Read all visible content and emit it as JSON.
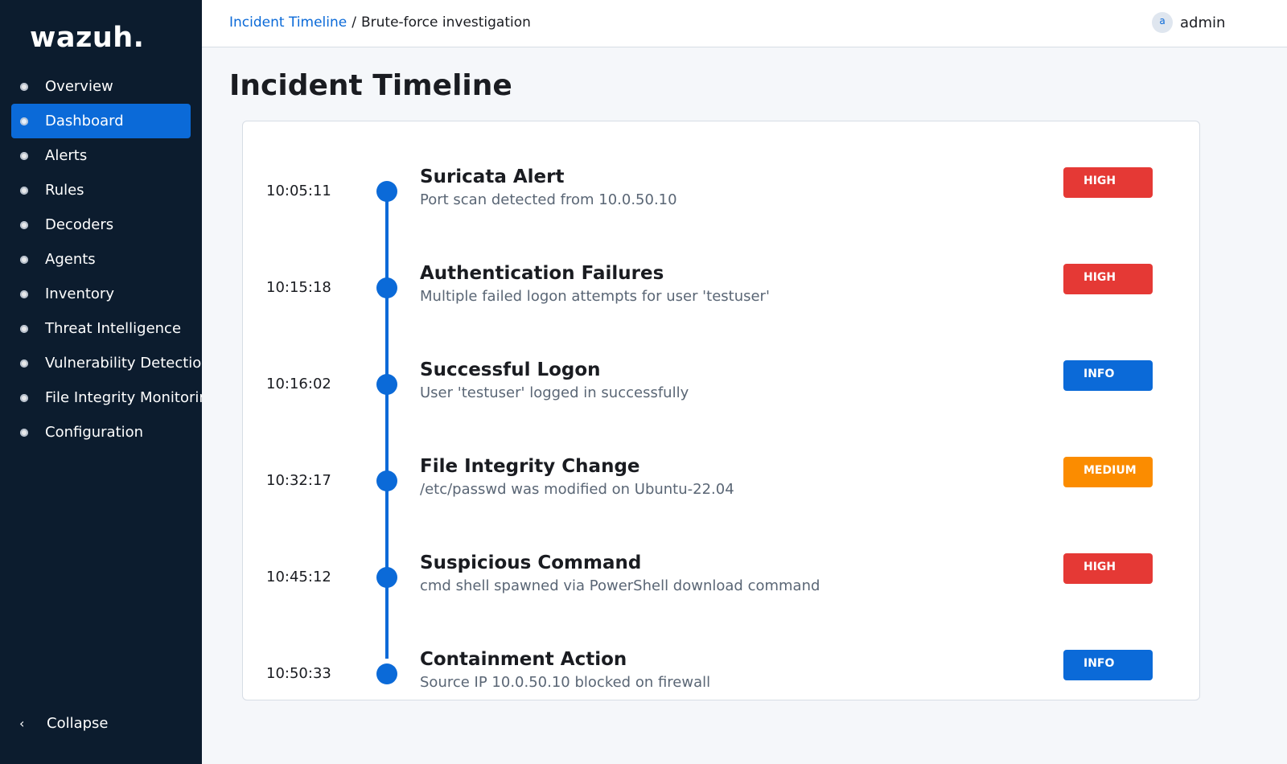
{
  "sidebar": {
    "logo": "wazuh.",
    "items": [
      {
        "label": "Overview"
      },
      {
        "label": "Dashboard"
      },
      {
        "label": "Alerts"
      },
      {
        "label": "Rules"
      },
      {
        "label": "Decoders"
      },
      {
        "label": "Agents"
      },
      {
        "label": "Inventory"
      },
      {
        "label": "Threat Intelligence"
      },
      {
        "label": "Vulnerability Detection"
      },
      {
        "label": "File Integrity Monitoring"
      },
      {
        "label": "Configuration"
      }
    ],
    "active_item": "Dashboard",
    "collapse_label": "Collapse",
    "collapse_icon": "chevron-left-icon"
  },
  "topbar": {
    "breadcrumb": {
      "link": "Incident Timeline",
      "separator": "/",
      "current": "Brute-force investigation"
    },
    "user": {
      "avatar_letter": "a",
      "name": "admin"
    }
  },
  "page": {
    "title": "Incident Timeline"
  },
  "timeline": {
    "events": [
      {
        "time": "10:05:11",
        "title": "Suricata Alert",
        "description": "Port scan detected from 10.0.50.10",
        "severity": "HIGH"
      },
      {
        "time": "10:15:18",
        "title": "Authentication Failures",
        "description": "Multiple failed logon attempts for user 'testuser'",
        "severity": "HIGH"
      },
      {
        "time": "10:16:02",
        "title": "Successful Logon",
        "description": "User 'testuser' logged in successfully",
        "severity": "INFO"
      },
      {
        "time": "10:32:17",
        "title": "File Integrity Change",
        "description": "/etc/passwd was modified on Ubuntu-22.04",
        "severity": "MEDIUM"
      },
      {
        "time": "10:45:12",
        "title": "Suspicious Command",
        "description": "cmd shell spawned via PowerShell download command",
        "severity": "HIGH"
      },
      {
        "time": "10:50:33",
        "title": "Containment Action",
        "description": "Source IP 10.0.50.10 blocked on firewall",
        "severity": "INFO"
      }
    ]
  },
  "colors": {
    "sidebar_bg": "#0c1c2e",
    "accent": "#0b6ad8",
    "severity_high": "#e53935",
    "severity_medium": "#fb8c00",
    "severity_info": "#0b6ad8"
  }
}
